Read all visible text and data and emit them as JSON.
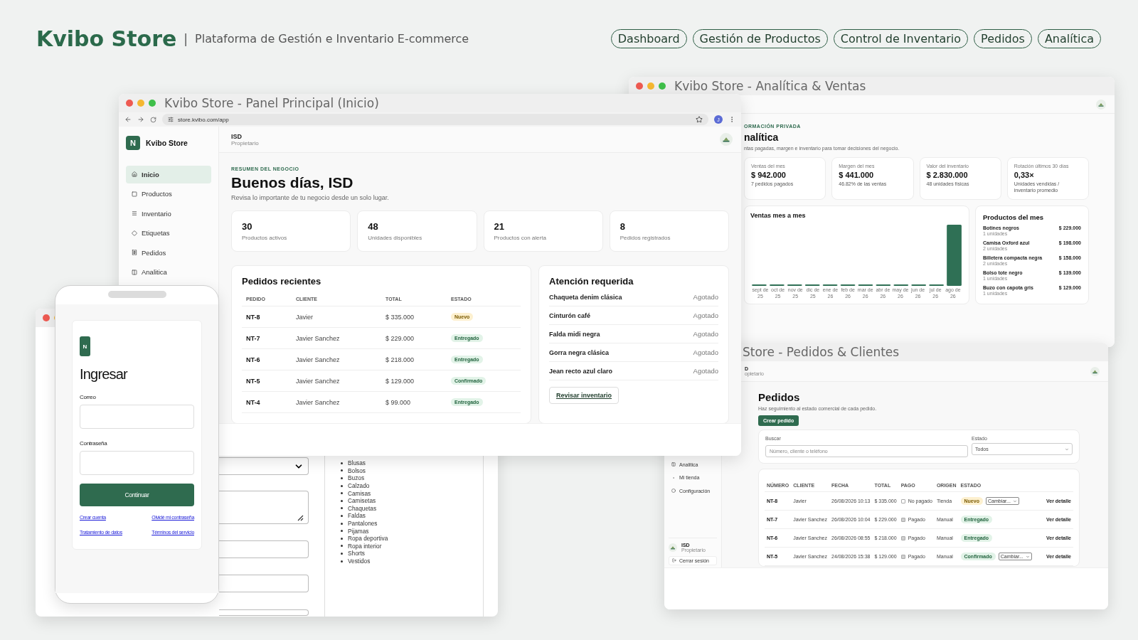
{
  "header": {
    "brand": "Kvibo Store",
    "separator": "|",
    "subtitle": "Plataforma de Gestión e Inventario E-commerce"
  },
  "nav": [
    "Dashboard",
    "Gestión de Productos",
    "Control de Inventario",
    "Pedidos",
    "Analítica"
  ],
  "form_window": {
    "categories": [
      "Blusas",
      "Bolsos",
      "Buzos",
      "Calzado",
      "Camisas",
      "Camisetas",
      "Chaquetas",
      "Faldas",
      "Pantalones",
      "Pijamas",
      "Ropa deportiva",
      "Ropa interior",
      "Shorts",
      "Vestidos"
    ]
  },
  "analytics_window": {
    "title": "Kvibo Store - Analítica & Ventas",
    "eyebrow": "ORMACIÓN PRIVADA",
    "heading": "nalítica",
    "description": "ntas pagadas, margen e inventario para tomar decisiones del negocio.",
    "kpis": [
      {
        "label": "Ventas del mes",
        "value": "$ 942.000",
        "note": "7 pedidos pagados"
      },
      {
        "label": "Margen del mes",
        "value": "$ 441.000",
        "note": "46.82% de las ventas"
      },
      {
        "label": "Valor del inventario",
        "value": "$ 2.830.000",
        "note": "48 unidades físicas"
      },
      {
        "label": "Rotación últimos 30 días",
        "value": "0,33×",
        "note": "Unidades vendidas / inventario promedio"
      }
    ],
    "chart": {
      "title": "Ventas mes a mes",
      "months": [
        "sept de 25",
        "oct de 25",
        "nov de 25",
        "dic de 25",
        "ene de 26",
        "feb de 26",
        "mar de 26",
        "abr de 26",
        "may de 26",
        "jun de 26",
        "jul de 26",
        "ago de 26"
      ]
    },
    "top_products": {
      "title": "Productos del mes",
      "items": [
        {
          "name": "Botines negros",
          "units": "1 unidades",
          "amount": "$ 229.000"
        },
        {
          "name": "Camisa Oxford azul",
          "units": "2 unidades",
          "amount": "$ 198.000"
        },
        {
          "name": "Billetera compacta negra",
          "units": "2 unidades",
          "amount": "$ 158.000"
        },
        {
          "name": "Bolso tote negro",
          "units": "1 unidades",
          "amount": "$ 139.000"
        },
        {
          "name": "Buzo con capota gris",
          "units": "1 unidades",
          "amount": "$ 129.000"
        }
      ]
    }
  },
  "orders_window": {
    "title": "Store - Pedidos & Clientes",
    "user": {
      "name": "D",
      "role": "opietario"
    },
    "sidebar": {
      "items": [
        "Analitica",
        "Mi tienda",
        "Configuración"
      ],
      "user": {
        "name": "ISD",
        "role": "Propietario"
      },
      "logout": "Cerrar sesión"
    },
    "heading": "Pedidos",
    "description": "Haz seguimiento al estado comercial de cada pedido.",
    "create_button": "Crear pedido",
    "search": {
      "label": "Buscar",
      "placeholder": "Número, cliente o teléfono"
    },
    "status_filter": {
      "label": "Estado",
      "value": "Todos"
    },
    "columns": [
      "NÚMERO",
      "CLIENTE",
      "FECHA",
      "TOTAL",
      "PAGO",
      "ORIGEN",
      "ESTADO"
    ],
    "rows": [
      {
        "id": "NT-8",
        "client": "Javier",
        "date": "26/08/2026 10:13",
        "total": "$ 335.000",
        "paid": false,
        "payment": "No pagado",
        "origin": "Tienda",
        "status": "Nuevo",
        "kind": "new",
        "change": "Cambiar...",
        "action": "Ver detalle"
      },
      {
        "id": "NT-7",
        "client": "Javier Sanchez",
        "date": "26/08/2026 10:04",
        "total": "$ 229.000",
        "paid": true,
        "payment": "Pagado",
        "origin": "Manual",
        "status": "Entregado",
        "kind": "delivered",
        "action": "Ver detalle"
      },
      {
        "id": "NT-6",
        "client": "Javier Sanchez",
        "date": "26/08/2026 08:55",
        "total": "$ 218.000",
        "paid": true,
        "payment": "Pagado",
        "origin": "Manual",
        "status": "Entregado",
        "kind": "delivered",
        "action": "Ver detalle"
      },
      {
        "id": "NT-5",
        "client": "Javier Sanchez",
        "date": "24/08/2026 15:38",
        "total": "$ 129.000",
        "paid": true,
        "payment": "Pagado",
        "origin": "Manual",
        "status": "Confirmado",
        "kind": "confirmed",
        "change": "Cambiar...",
        "action": "Ver detalle"
      }
    ]
  },
  "main_window": {
    "title": "Kvibo Store - Panel Principal (Inicio)",
    "url": "store.kvibo.com/app",
    "profile_initial": "J",
    "sidebar": {
      "logo": "N",
      "brand": "Kvibo Store",
      "items": [
        {
          "label": "Inicio",
          "selected": true
        },
        {
          "label": "Productos",
          "selected": false
        },
        {
          "label": "Inventario",
          "selected": false
        },
        {
          "label": "Etiquetas",
          "selected": false
        },
        {
          "label": "Pedidos",
          "selected": false
        },
        {
          "label": "Analitica",
          "selected": false
        }
      ]
    },
    "user": {
      "name": "ISD",
      "role": "Propietario"
    },
    "eyebrow": "RESUMEN DEL NEGOCIO",
    "heading": "Buenos días, ISD",
    "description": "Revisa lo importante de tu negocio desde un solo lugar.",
    "stats": [
      {
        "value": "30",
        "label": "Productos activos"
      },
      {
        "value": "48",
        "label": "Unidades disponibles"
      },
      {
        "value": "21",
        "label": "Productos con alerta"
      },
      {
        "value": "8",
        "label": "Pedidos registrados"
      }
    ],
    "recent_orders": {
      "title": "Pedidos recientes",
      "columns": [
        "PEDIDO",
        "CLIENTE",
        "TOTAL",
        "ESTADO"
      ],
      "rows": [
        {
          "id": "NT-8",
          "client": "Javier",
          "total": "$ 335.000",
          "status": "Nuevo",
          "kind": "new"
        },
        {
          "id": "NT-7",
          "client": "Javier Sanchez",
          "total": "$ 229.000",
          "status": "Entregado",
          "kind": "delivered"
        },
        {
          "id": "NT-6",
          "client": "Javier Sanchez",
          "total": "$ 218.000",
          "status": "Entregado",
          "kind": "delivered"
        },
        {
          "id": "NT-5",
          "client": "Javier Sanchez",
          "total": "$ 129.000",
          "status": "Confirmado",
          "kind": "confirmed"
        },
        {
          "id": "NT-4",
          "client": "Javier Sanchez",
          "total": "$ 99.000",
          "status": "Entregado",
          "kind": "delivered"
        }
      ]
    },
    "attention": {
      "title": "Atención requerida",
      "items": [
        {
          "name": "Chaqueta denim clásica",
          "status": "Agotado"
        },
        {
          "name": "Cinturón café",
          "status": "Agotado"
        },
        {
          "name": "Falda midi negra",
          "status": "Agotado"
        },
        {
          "name": "Gorra negra clásica",
          "status": "Agotado"
        },
        {
          "name": "Jean recto azul claro",
          "status": "Agotado"
        }
      ],
      "button": "Revisar inventario"
    }
  },
  "login_phone": {
    "logo": "N",
    "title": "Ingresar",
    "fields": [
      {
        "label": "Correo"
      },
      {
        "label": "Contraseña"
      }
    ],
    "submit": "Continuar",
    "links": [
      "Crear cuenta",
      "Olvidé mi contraseña",
      "Tratamiento de datos",
      "Términos del servicio"
    ]
  }
}
